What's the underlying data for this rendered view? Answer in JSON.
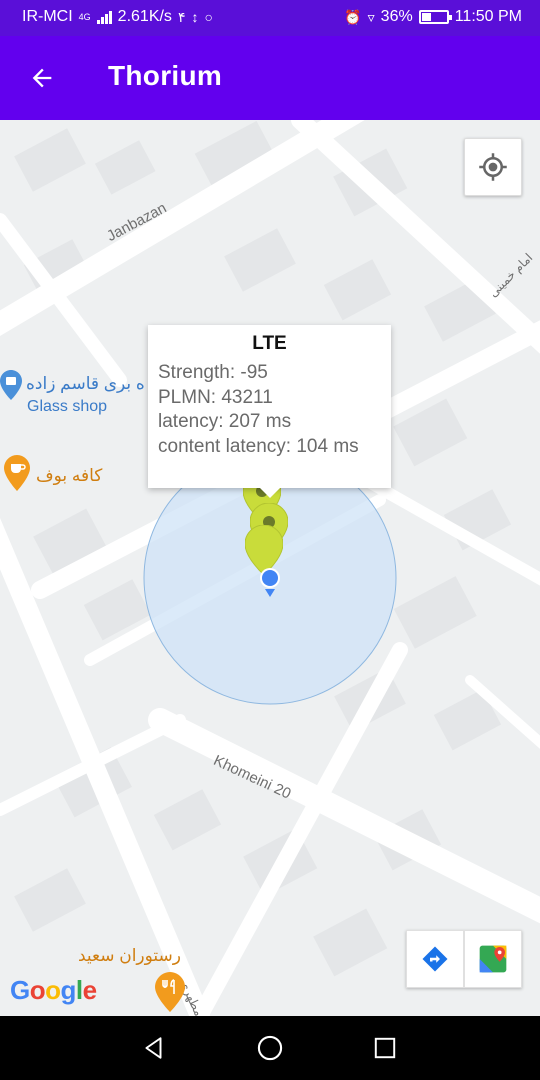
{
  "status_bar": {
    "carrier": "IR-MCI",
    "network": "4G",
    "speed": "2.61K/s",
    "extra": "۴",
    "battery": "36%",
    "battery_level": 0.36,
    "time": "11:50 PM",
    "icons": [
      "usb-icon",
      "whatsapp-icon",
      "alarm-icon",
      "location-icon",
      "battery-icon"
    ]
  },
  "app_bar": {
    "title": "Thorium",
    "back_icon": "arrow-back-icon",
    "color": "#6200ee"
  },
  "map": {
    "streets": [
      "Janbazan",
      "امام خمینی",
      "Khomeini 20",
      "مطهری"
    ],
    "pois": {
      "glass_shop_fa": "ه بری قاسم زاده",
      "glass_shop_en": "Glass shop",
      "cafe": "کافه بوف",
      "restaurant": "رستوران سعید"
    },
    "google_logo": "Google",
    "my_location_icon": "my-location-icon",
    "directions_icon": "directions-icon",
    "maps_app_icon": "google-maps-icon"
  },
  "info_window": {
    "title": "LTE",
    "strength": "Strength: -95",
    "plmn": "PLMN: 43211",
    "latency": "latency: 207 ms",
    "content_latency": "content latency: 104 ms"
  },
  "nav_bar": {
    "back_icon": "nav-back-icon",
    "home_icon": "nav-home-icon",
    "recents_icon": "nav-recents-icon"
  },
  "colors": {
    "marker": "#c8dc3c",
    "accuracy_circle": "#cfe3f7",
    "location_dot": "#4285f4"
  }
}
